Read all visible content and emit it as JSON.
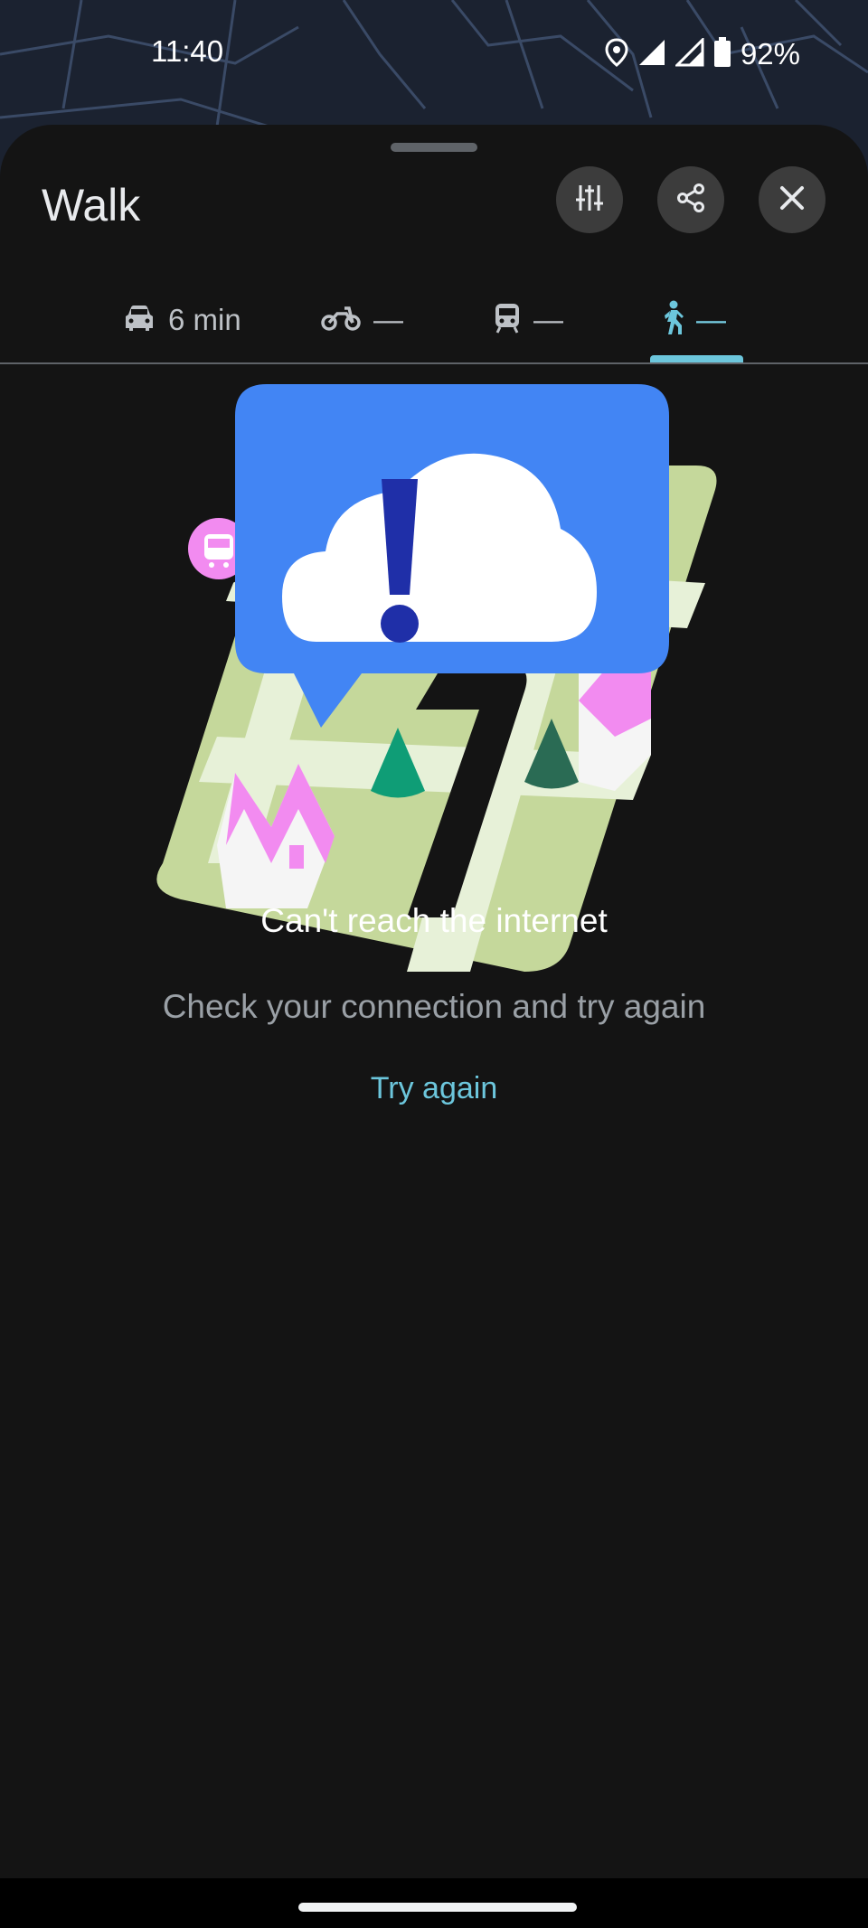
{
  "status_bar": {
    "time": "11:40",
    "battery": "92%",
    "icons": [
      "location-icon",
      "signal-icon",
      "signal-icon",
      "battery-icon"
    ]
  },
  "sheet": {
    "title": "Walk",
    "actions": [
      "tune-icon",
      "share-icon",
      "close-icon"
    ]
  },
  "tabs": [
    {
      "icon": "car-icon",
      "label": "6 min",
      "active": false
    },
    {
      "icon": "motorcycle-icon",
      "label": "—",
      "active": false
    },
    {
      "icon": "train-icon",
      "label": "—",
      "active": false
    },
    {
      "icon": "walk-icon",
      "label": "—",
      "active": true
    }
  ],
  "message": {
    "title": "Can't reach the internet",
    "subtitle": "Check your connection and try again",
    "retry_label": "Try again"
  },
  "colors": {
    "accent": "#6cc6dc",
    "sheet_bg": "#141414",
    "bubble_blue": "#4285f4",
    "map_green": "#c5d89b",
    "pink": "#f28bf0"
  }
}
